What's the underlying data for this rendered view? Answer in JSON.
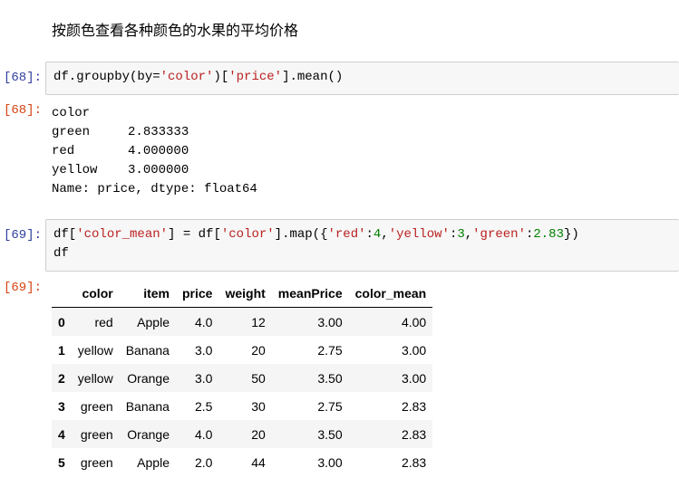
{
  "markdown": {
    "heading": "按颜色查看各种颜色的水果的平均价格"
  },
  "cell68": {
    "in_prompt": "[68]:",
    "out_prompt": "[68]:",
    "code": {
      "p1": "df.groupby(by=",
      "s1": "'color'",
      "p2": ")[",
      "s2": "'price'",
      "p3": "].mean()"
    },
    "output_lines": [
      "color",
      "green     2.833333",
      "red       4.000000",
      "yellow    3.000000",
      "Name: price, dtype: float64"
    ]
  },
  "cell69": {
    "in_prompt": "[69]:",
    "out_prompt": "[69]:",
    "code_line1": {
      "p1": "df[",
      "s1": "'color_mean'",
      "p2": "] = df[",
      "s2": "'color'",
      "p3": "].map({",
      "s3": "'red'",
      "p4": ":",
      "n1": "4",
      "p5": ",",
      "s4": "'yellow'",
      "p6": ":",
      "n2": "3",
      "p7": ",",
      "s5": "'green'",
      "p8": ":",
      "n3": "2.83",
      "p9": "})"
    },
    "code_line2": "df",
    "table": {
      "columns": [
        "",
        "color",
        "item",
        "price",
        "weight",
        "meanPrice",
        "color_mean"
      ],
      "rows": [
        [
          "0",
          "red",
          "Apple",
          "4.0",
          "12",
          "3.00",
          "4.00"
        ],
        [
          "1",
          "yellow",
          "Banana",
          "3.0",
          "20",
          "2.75",
          "3.00"
        ],
        [
          "2",
          "yellow",
          "Orange",
          "3.0",
          "50",
          "3.50",
          "3.00"
        ],
        [
          "3",
          "green",
          "Banana",
          "2.5",
          "30",
          "2.75",
          "2.83"
        ],
        [
          "4",
          "green",
          "Orange",
          "4.0",
          "20",
          "3.50",
          "2.83"
        ],
        [
          "5",
          "green",
          "Apple",
          "2.0",
          "44",
          "3.00",
          "2.83"
        ]
      ]
    }
  },
  "colors": {
    "in_prompt": "#303f9f",
    "out_prompt": "#d84315",
    "string": "#ba2121",
    "number": "#008000",
    "cell_bg": "#f7f7f7"
  }
}
